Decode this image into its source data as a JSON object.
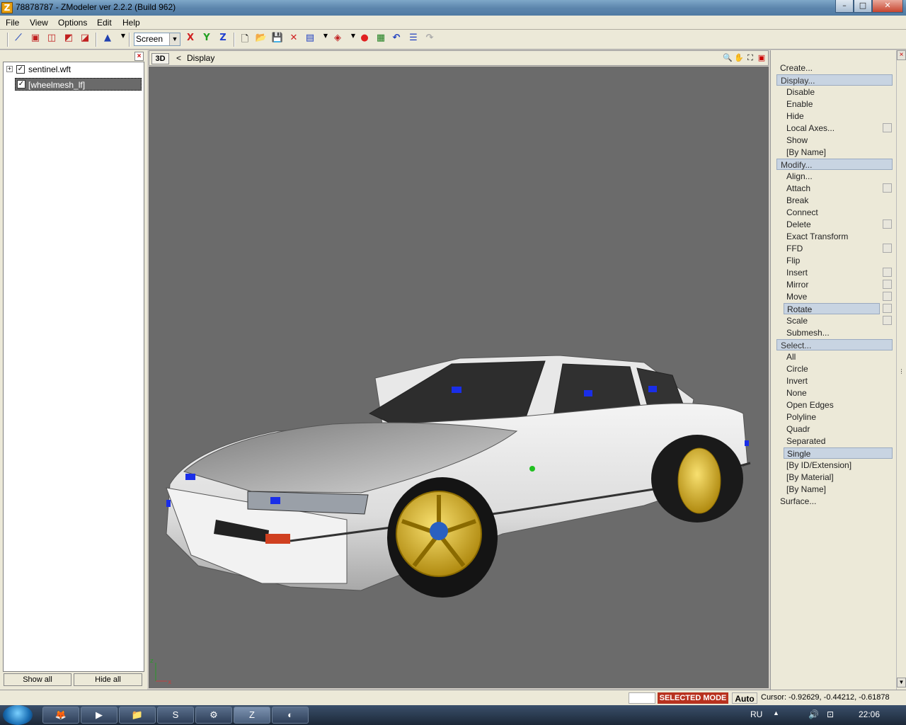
{
  "window": {
    "title": "78878787 - ZModeler ver 2.2.2 (Build 962)",
    "app_icon": "Z",
    "minimize": "–",
    "maximize": "□",
    "close": "✕"
  },
  "menu": [
    "File",
    "View",
    "Options",
    "Edit",
    "Help"
  ],
  "toolbar": {
    "coord_system": "Screen",
    "axis_x": "X",
    "axis_y": "Y",
    "axis_z": "Z"
  },
  "tree": {
    "items": [
      {
        "label": "sentinel.wft",
        "checked": true
      },
      {
        "label": "[wheelmesh_lf]",
        "checked": true
      }
    ],
    "show_all": "Show all",
    "hide_all": "Hide all"
  },
  "viewport": {
    "view_label": "3D",
    "arrow": "<",
    "title": "Display",
    "axis_x": "x",
    "axis_z": "z"
  },
  "commands": {
    "create": "Create...",
    "display": "Display...",
    "display_items": [
      "Disable",
      "Enable",
      "Hide",
      "Local Axes...",
      "Show",
      "[By Name]"
    ],
    "modify": "Modify...",
    "modify_items": [
      "Align...",
      "Attach",
      "Break",
      "Connect",
      "Delete",
      "Exact Transform",
      "FFD",
      "Flip",
      "Insert",
      "Mirror",
      "Move",
      "Rotate",
      "Scale",
      "Submesh..."
    ],
    "select": "Select...",
    "select_items": [
      "All",
      "Circle",
      "Invert",
      "None",
      "Open Edges",
      "Polyline",
      "Quadr",
      "Separated",
      "Single",
      "[By ID/Extension]",
      "[By Material]",
      "[By Name]"
    ],
    "surface": "Surface..."
  },
  "status": {
    "mode": "SELECTED MODE",
    "auto": "Auto",
    "cursor": "Cursor: -0.92629, -0.44212, -0.61878"
  },
  "taskbar": {
    "language": "RU",
    "clock": "22:06"
  }
}
